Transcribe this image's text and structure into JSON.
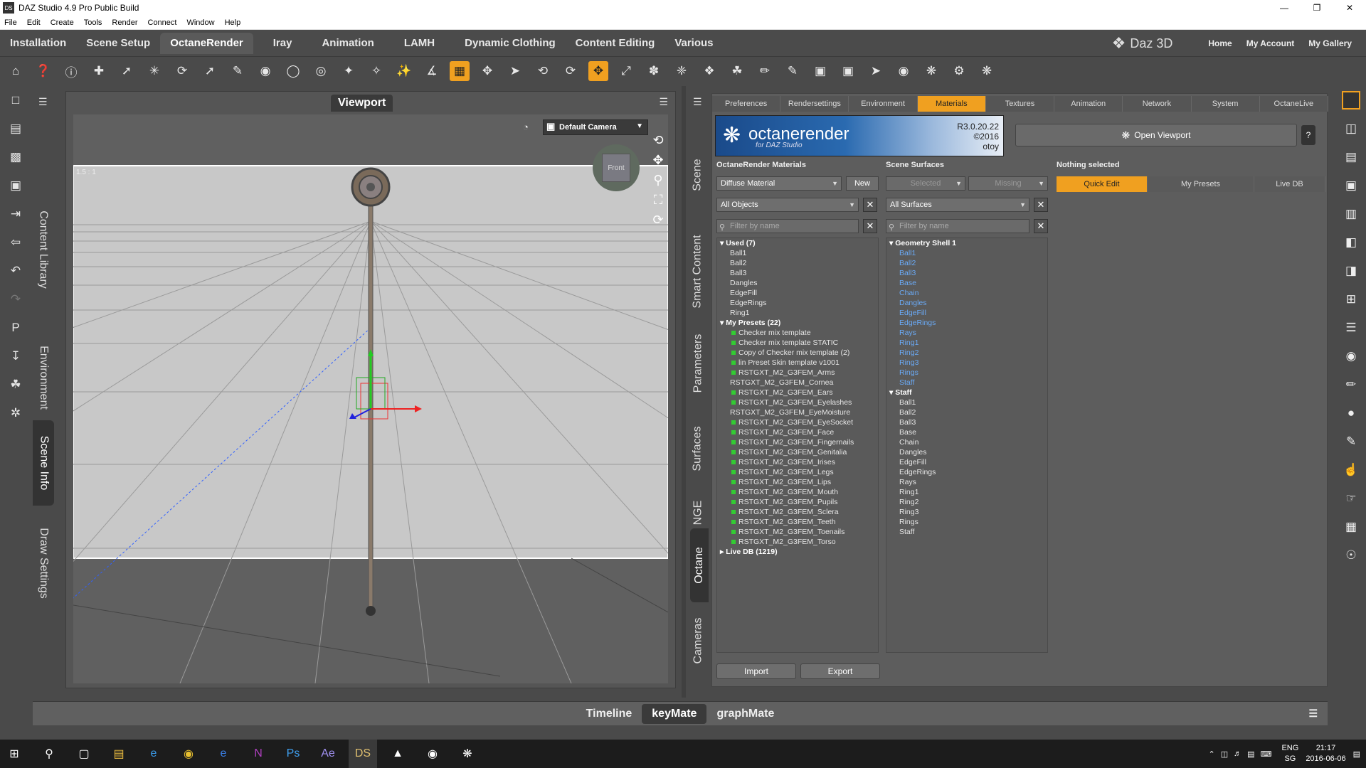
{
  "window": {
    "title": "DAZ Studio 4.9 Pro Public Build",
    "icon": "DS"
  },
  "menu": [
    "File",
    "Edit",
    "Create",
    "Tools",
    "Render",
    "Connect",
    "Window",
    "Help"
  ],
  "layouts": {
    "tabs": [
      "Installation",
      "Scene Setup",
      "OctaneRender",
      "Iray",
      "Animation",
      "LAMH",
      "Dynamic Clothing",
      "Content Editing",
      "Various"
    ],
    "active": "OctaneRender",
    "brand": "Daz 3D",
    "links": [
      "Home",
      "My Account",
      "My Gallery"
    ]
  },
  "left_tabs": [
    "Content Library",
    "Environment",
    "Scene Info",
    "Draw Settings"
  ],
  "viewport": {
    "title": "Viewport",
    "camera": "Default Camera",
    "aspect": "1.5 : 1",
    "cube_face": "Front"
  },
  "side_tabs": [
    "Scene",
    "Smart Content",
    "Parameters",
    "Surfaces",
    "NGE",
    "Octane",
    "Cameras"
  ],
  "octane": {
    "tabs": [
      "Preferences",
      "Rendersettings",
      "Environment",
      "Materials",
      "Textures",
      "Animation",
      "Network",
      "System",
      "OctaneLive"
    ],
    "active_tab": "Materials",
    "banner": {
      "name": "octanerender",
      "sub": "for DAZ Studio",
      "version": "R3.0.20.22",
      "year": "©2016",
      "maker": "otoy"
    },
    "open_viewport": "Open Viewport",
    "materials_header": "OctaneRender Materials",
    "surfaces_header": "Scene Surfaces",
    "selection_header": "Nothing selected",
    "material_type": "Diffuse Material",
    "new_btn": "New",
    "selected_btn": "Selected",
    "missing_btn": "Missing",
    "objects_filter": "All Objects",
    "surfaces_filter": "All Surfaces",
    "filter_placeholder": "Filter by name",
    "right_tabs": [
      "Quick Edit",
      "My Presets",
      "Live DB"
    ],
    "right_active": "Quick Edit",
    "import_btn": "Import",
    "export_btn": "Export",
    "materials_list": [
      {
        "t": "Used (7)",
        "k": "grp"
      },
      {
        "t": "Ball1",
        "k": "i"
      },
      {
        "t": "Ball2",
        "k": "i"
      },
      {
        "t": "Ball3",
        "k": "i"
      },
      {
        "t": "Dangles",
        "k": "i"
      },
      {
        "t": "EdgeFill",
        "k": "i"
      },
      {
        "t": "EdgeRings",
        "k": "i"
      },
      {
        "t": "Ring1",
        "k": "i"
      },
      {
        "t": "My Presets (22)",
        "k": "grp"
      },
      {
        "t": "Checker mix template",
        "k": "g"
      },
      {
        "t": "Checker mix template STATIC",
        "k": "g"
      },
      {
        "t": "Copy of Checker mix template (2)",
        "k": "g"
      },
      {
        "t": "lin Preset Skin template v1001",
        "k": "g"
      },
      {
        "t": "RSTGXT_M2_G3FEM_Arms",
        "k": "g"
      },
      {
        "t": "RSTGXT_M2_G3FEM_Cornea",
        "k": "i"
      },
      {
        "t": "RSTGXT_M2_G3FEM_Ears",
        "k": "g"
      },
      {
        "t": "RSTGXT_M2_G3FEM_Eyelashes",
        "k": "g"
      },
      {
        "t": "RSTGXT_M2_G3FEM_EyeMoisture",
        "k": "i"
      },
      {
        "t": "RSTGXT_M2_G3FEM_EyeSocket",
        "k": "g"
      },
      {
        "t": "RSTGXT_M2_G3FEM_Face",
        "k": "g"
      },
      {
        "t": "RSTGXT_M2_G3FEM_Fingernails",
        "k": "g"
      },
      {
        "t": "RSTGXT_M2_G3FEM_Genitalia",
        "k": "g"
      },
      {
        "t": "RSTGXT_M2_G3FEM_Irises",
        "k": "g"
      },
      {
        "t": "RSTGXT_M2_G3FEM_Legs",
        "k": "g"
      },
      {
        "t": "RSTGXT_M2_G3FEM_Lips",
        "k": "g"
      },
      {
        "t": "RSTGXT_M2_G3FEM_Mouth",
        "k": "g"
      },
      {
        "t": "RSTGXT_M2_G3FEM_Pupils",
        "k": "g"
      },
      {
        "t": "RSTGXT_M2_G3FEM_Sclera",
        "k": "g"
      },
      {
        "t": "RSTGXT_M2_G3FEM_Teeth",
        "k": "g"
      },
      {
        "t": "RSTGXT_M2_G3FEM_Toenails",
        "k": "g"
      },
      {
        "t": "RSTGXT_M2_G3FEM_Torso",
        "k": "g"
      },
      {
        "t": "Live DB (1219)",
        "k": "grpc"
      }
    ],
    "surfaces_list": [
      {
        "t": "Geometry Shell 1",
        "k": "grp"
      },
      {
        "t": "Ball1",
        "k": "b"
      },
      {
        "t": "Ball2",
        "k": "b"
      },
      {
        "t": "Ball3",
        "k": "b"
      },
      {
        "t": "Base",
        "k": "b"
      },
      {
        "t": "Chain",
        "k": "b"
      },
      {
        "t": "Dangles",
        "k": "b"
      },
      {
        "t": "EdgeFill",
        "k": "b"
      },
      {
        "t": "EdgeRings",
        "k": "b"
      },
      {
        "t": "Rays",
        "k": "b"
      },
      {
        "t": "Ring1",
        "k": "b"
      },
      {
        "t": "Ring2",
        "k": "b"
      },
      {
        "t": "Ring3",
        "k": "b"
      },
      {
        "t": "Rings",
        "k": "b"
      },
      {
        "t": "Staff",
        "k": "b"
      },
      {
        "t": "Staff",
        "k": "grp"
      },
      {
        "t": "Ball1",
        "k": "i"
      },
      {
        "t": "Ball2",
        "k": "i"
      },
      {
        "t": "Ball3",
        "k": "i"
      },
      {
        "t": "Base",
        "k": "i"
      },
      {
        "t": "Chain",
        "k": "i"
      },
      {
        "t": "Dangles",
        "k": "i"
      },
      {
        "t": "EdgeFill",
        "k": "i"
      },
      {
        "t": "EdgeRings",
        "k": "i"
      },
      {
        "t": "Rays",
        "k": "i"
      },
      {
        "t": "Ring1",
        "k": "i"
      },
      {
        "t": "Ring2",
        "k": "i"
      },
      {
        "t": "Ring3",
        "k": "i"
      },
      {
        "t": "Rings",
        "k": "i"
      },
      {
        "t": "Staff",
        "k": "i"
      }
    ]
  },
  "bottom_tabs": [
    "Timeline",
    "keyMate",
    "graphMate"
  ],
  "bottom_active": "keyMate",
  "taskbar": {
    "lang1": "ENG",
    "lang2": "SG",
    "time": "21:17",
    "date": "2016-06-06"
  },
  "colors": {
    "accent": "#f0a020",
    "surface_blue": "#6aaaf6",
    "preset_green": "#33cc33"
  }
}
